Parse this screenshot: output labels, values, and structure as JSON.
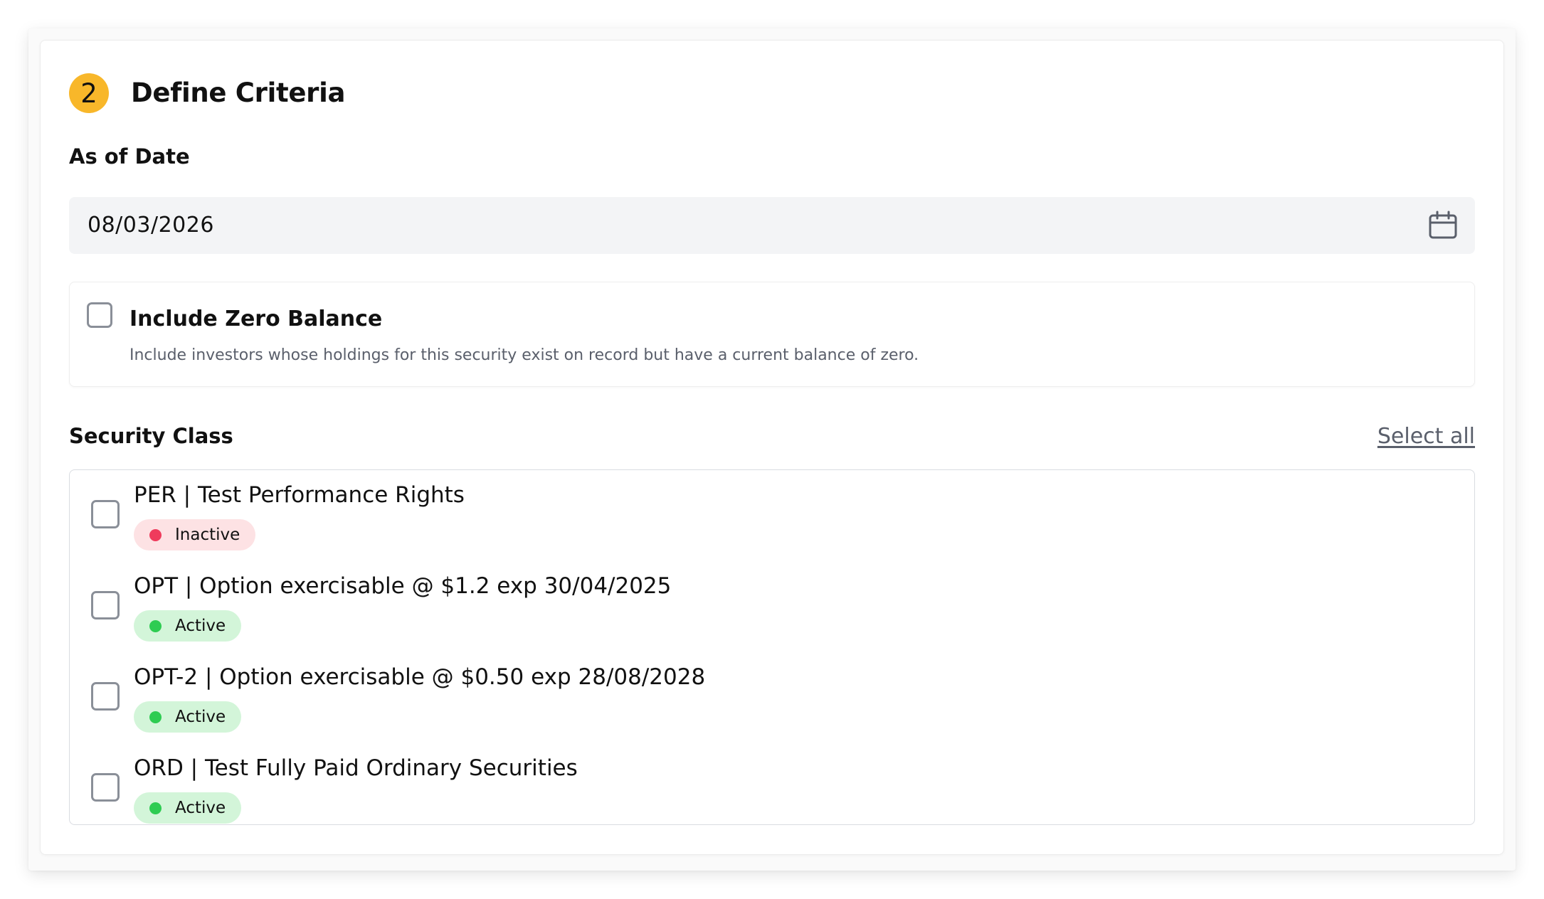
{
  "step": {
    "number": "2",
    "title": "Define Criteria"
  },
  "as_of_date": {
    "label": "As of Date",
    "value": "08/03/2026",
    "icon": "calendar-icon"
  },
  "zero_balance": {
    "checked": false,
    "title": "Include Zero Balance",
    "description": "Include investors whose holdings for this security exist on record but have a current balance of zero."
  },
  "security_class": {
    "label": "Security Class",
    "select_all_label": "Select all",
    "items": [
      {
        "label": "PER | Test Performance Rights",
        "status": "Inactive",
        "checked": false
      },
      {
        "label": "OPT | Option exercisable @ $1.2 exp 30/04/2025",
        "status": "Active",
        "checked": false
      },
      {
        "label": "OPT-2 | Option exercisable @ $0.50 exp 28/08/2028",
        "status": "Active",
        "checked": false
      },
      {
        "label": "ORD | Test Fully Paid Ordinary Securities",
        "status": "Active",
        "checked": false
      }
    ]
  },
  "colors": {
    "step_badge": "#f8b72a",
    "active_badge_bg": "#d3f5d9",
    "active_dot": "#2ecc52",
    "inactive_badge_bg": "#fde2e4",
    "inactive_dot": "#ef3b5c",
    "input_bg": "#f3f4f6",
    "muted_text": "#5a5f6b"
  }
}
